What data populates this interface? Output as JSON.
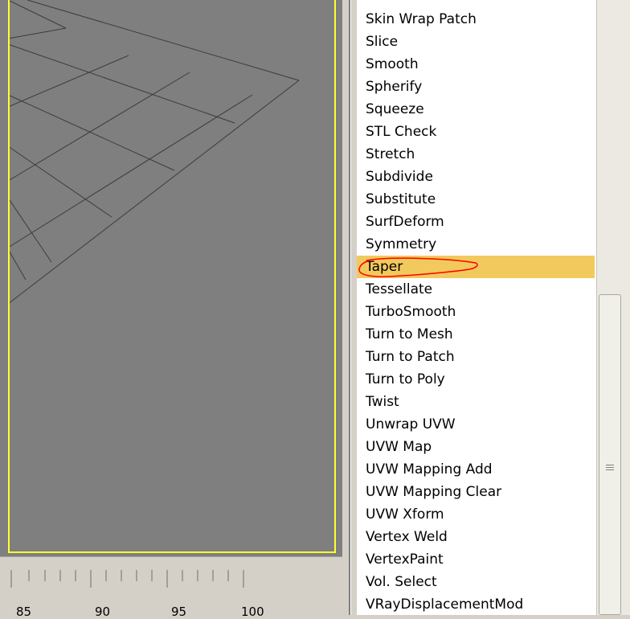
{
  "modifier_list": {
    "items": [
      "Skin Wrap Patch",
      "Slice",
      "Smooth",
      "Spherify",
      "Squeeze",
      "STL Check",
      "Stretch",
      "Subdivide",
      "Substitute",
      "SurfDeform",
      "Symmetry",
      "Taper",
      "Tessellate",
      "TurboSmooth",
      "Turn to Mesh",
      "Turn to Patch",
      "Turn to Poly",
      "Twist",
      "Unwrap UVW",
      "UVW Map",
      "UVW Mapping Add",
      "UVW Mapping Clear",
      "UVW Xform",
      "Vertex Weld",
      "VertexPaint",
      "Vol. Select",
      "VRayDisplacementMod"
    ],
    "selected": "Taper"
  },
  "timeline": {
    "labels": [
      "85",
      "90",
      "95",
      "100"
    ]
  },
  "colors": {
    "viewport_bg": "#7f7f7f",
    "active_border": "#ffff32",
    "selection": "#f2c95c",
    "annotation": "#ff0000"
  },
  "icons": {
    "scroll_grip": "grip-lines-icon"
  }
}
